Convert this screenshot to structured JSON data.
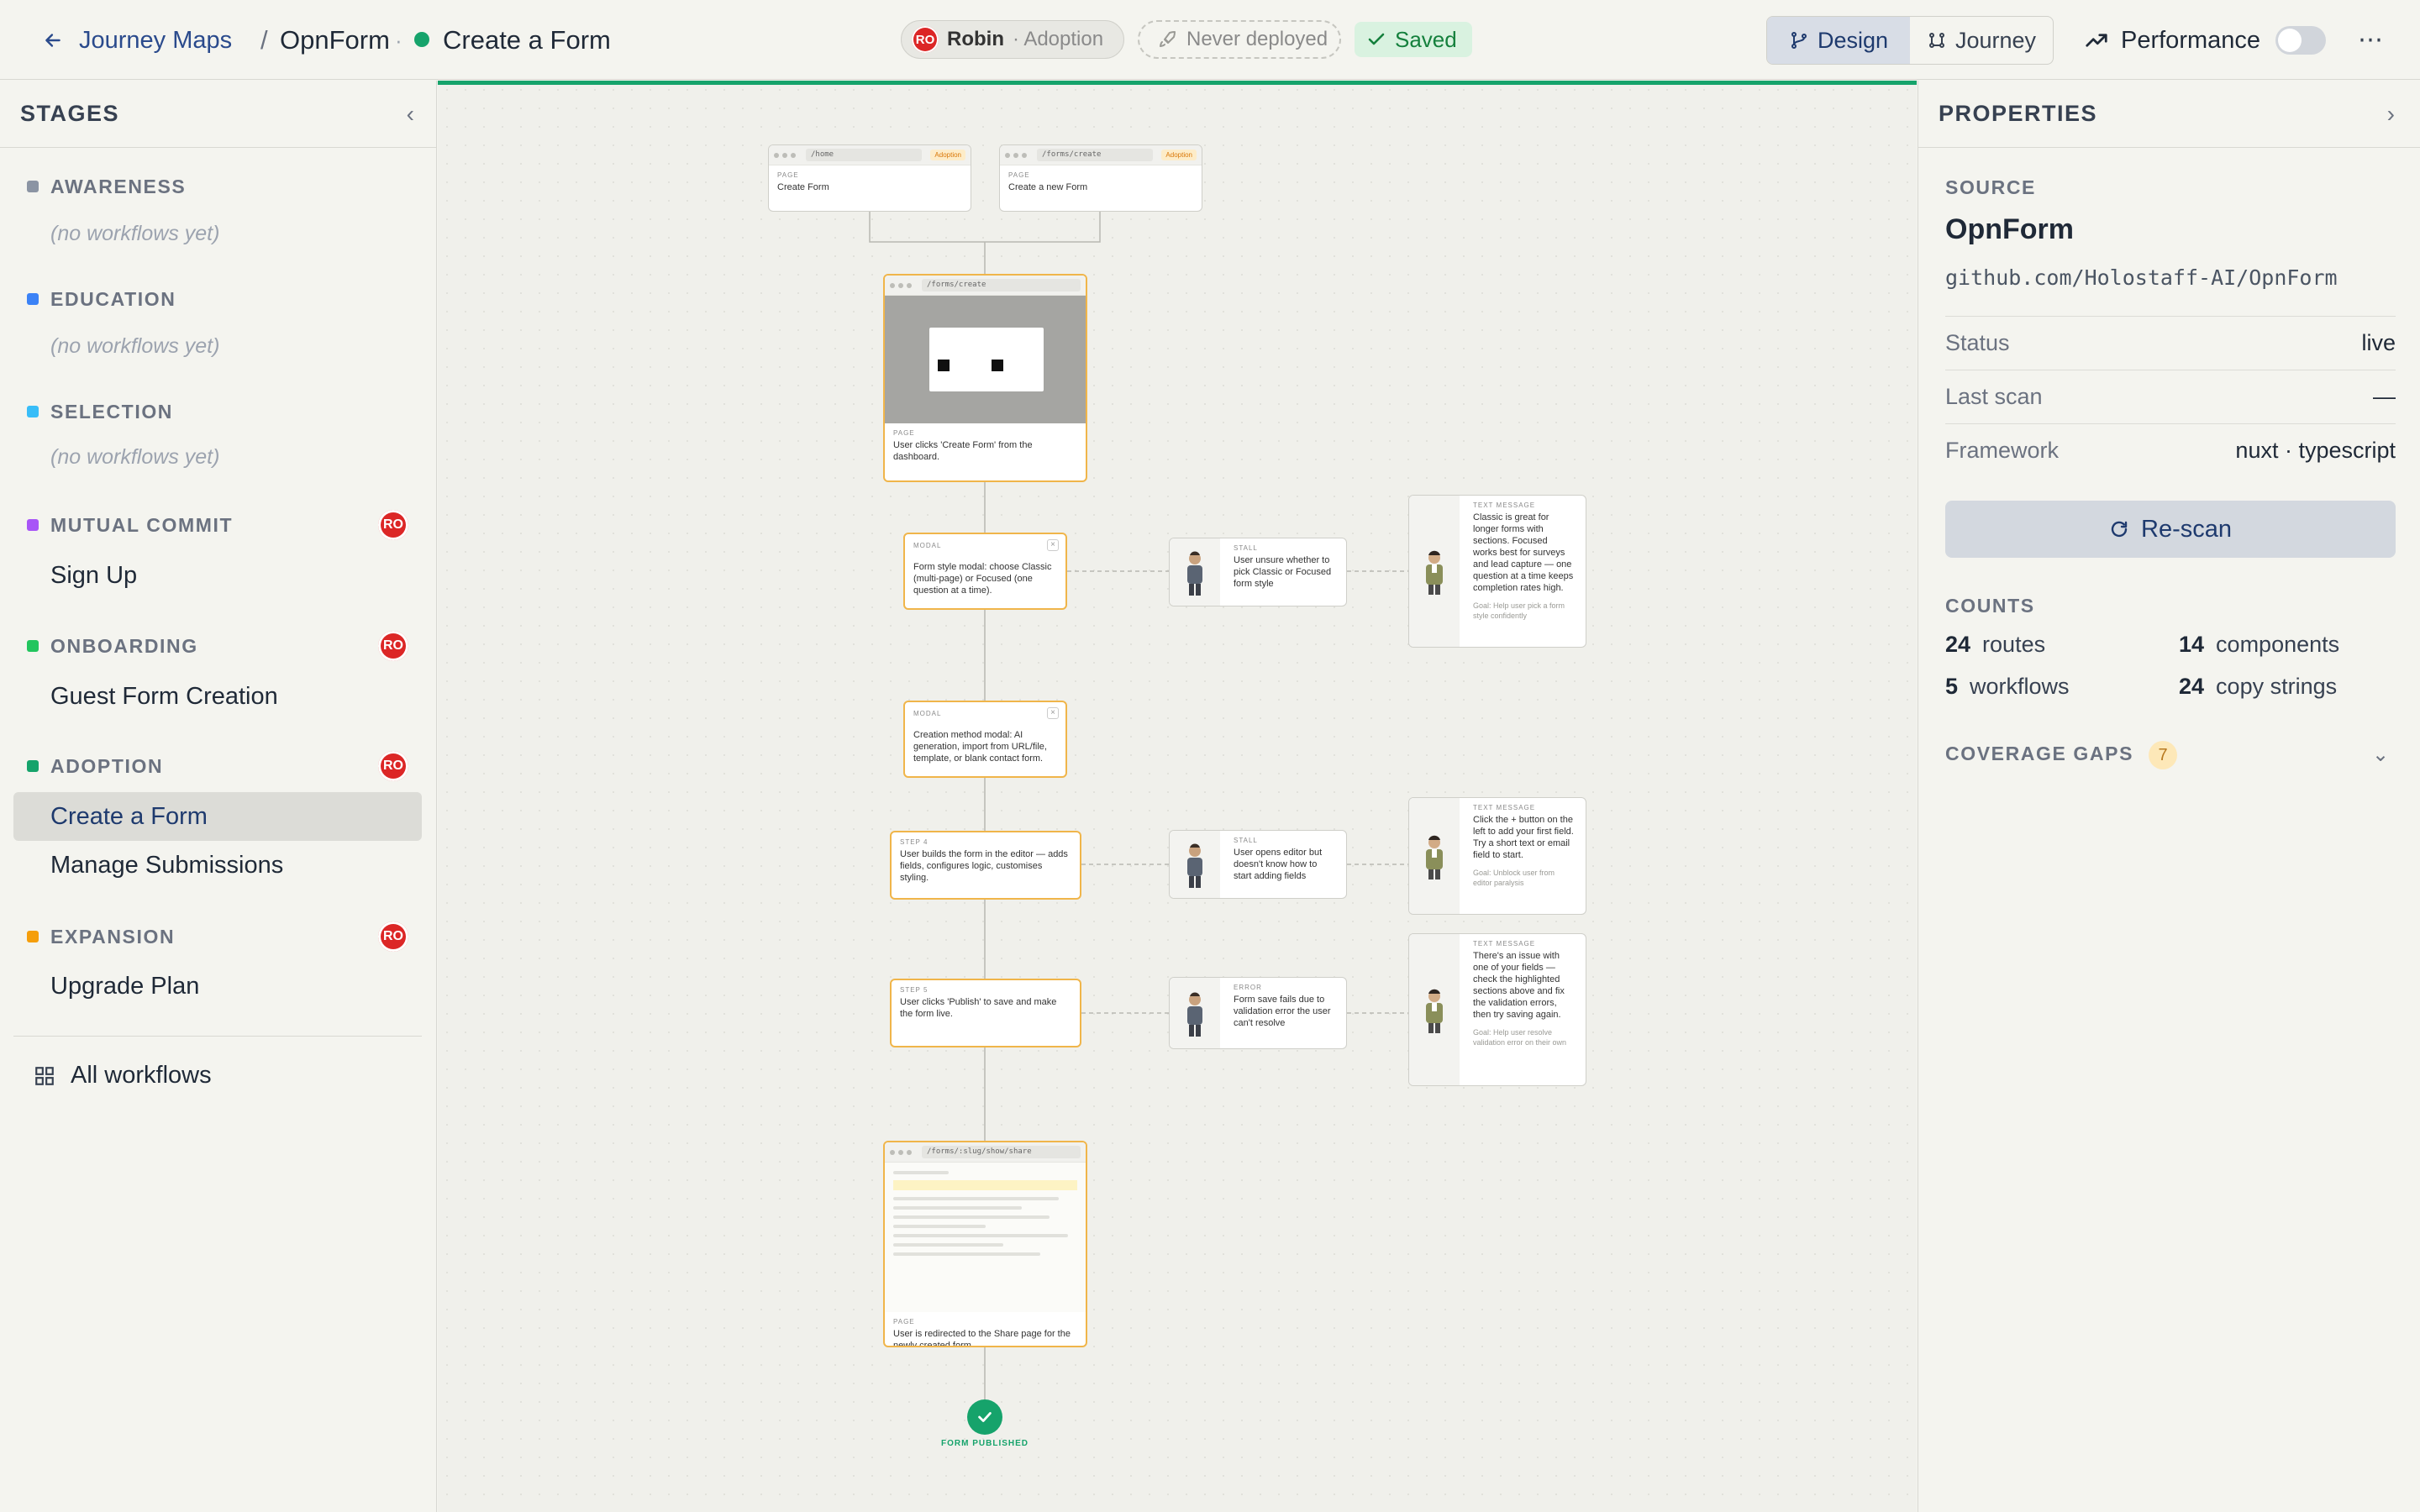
{
  "header": {
    "back_label": "Journey Maps",
    "separator": "/",
    "project": "OpnForm",
    "dot": "·",
    "workflow": "Create a Form",
    "owner_initials": "RO",
    "owner_name": "Robin",
    "owner_stage": "· Adoption",
    "deploy_status": "Never deployed",
    "save_status": "Saved",
    "view_design": "Design",
    "view_journey": "Journey",
    "performance_label": "Performance",
    "more": "⋯"
  },
  "sidebar": {
    "title": "STAGES",
    "stages": [
      {
        "name": "AWARENESS",
        "color": "#8b94a3",
        "empty": "(no workflows yet)"
      },
      {
        "name": "EDUCATION",
        "color": "#3b82f6",
        "empty": "(no workflows yet)"
      },
      {
        "name": "SELECTION",
        "color": "#38bdf8",
        "empty": "(no workflows yet)"
      },
      {
        "name": "MUTUAL COMMIT",
        "color": "#a855f7",
        "badge": "RO",
        "workflow": "Sign Up"
      },
      {
        "name": "ONBOARDING",
        "color": "#22c55e",
        "badge": "RO",
        "workflow": "Guest Form Creation"
      },
      {
        "name": "ADOPTION",
        "color": "#16a36b",
        "badge": "RO",
        "workflows": [
          "Create a Form",
          "Manage Submissions"
        ]
      },
      {
        "name": "EXPANSION",
        "color": "#f59e0b",
        "badge": "RO",
        "workflow": "Upgrade Plan"
      }
    ],
    "all_workflows": "All workflows"
  },
  "canvas": {
    "nodes": {
      "home": {
        "url": "/home",
        "tag": "Adoption",
        "kind": "PAGE",
        "text": "Create Form"
      },
      "forms_create_top": {
        "url": "/forms/create",
        "tag": "Adoption",
        "kind": "PAGE",
        "text": "Create a new Form"
      },
      "page_create": {
        "url": "/forms/create",
        "kind": "PAGE",
        "text": "User clicks 'Create Form' from the dashboard."
      },
      "modal1": {
        "kind": "MODAL",
        "text": "Form style modal: choose Classic (multi-page) or Focused (one question at a time)."
      },
      "stall1": {
        "kind": "STALL",
        "text": "User unsure whether to pick Classic or Focused form style"
      },
      "msg1": {
        "kind": "TEXT MESSAGE",
        "text": "Classic is great for longer forms with sections. Focused works best for surveys and lead capture — one question at a time keeps completion rates high.",
        "goal": "Goal: Help user pick a form style confidently"
      },
      "modal2": {
        "kind": "MODAL",
        "text": "Creation method modal: AI generation, import from URL/file, template, or blank contact form."
      },
      "step4": {
        "kind": "STEP 4",
        "text": "User builds the form in the editor — adds fields, configures logic, customises styling."
      },
      "stall2": {
        "kind": "STALL",
        "text": "User opens editor but doesn't know how to start adding fields"
      },
      "msg2": {
        "kind": "TEXT MESSAGE",
        "text": "Click the + button on the left to add your first field. Try a short text or email field to start.",
        "goal": "Goal: Unblock user from editor paralysis"
      },
      "step5": {
        "kind": "STEP 5",
        "text": "User clicks 'Publish' to save and make the form live."
      },
      "error1": {
        "kind": "ERROR",
        "text": "Form save fails due to validation error the user can't resolve"
      },
      "msg3": {
        "kind": "TEXT MESSAGE",
        "text": "There's an issue with one of your fields — check the highlighted sections above and fix the validation errors, then try saving again.",
        "goal": "Goal: Help user resolve validation error on their own"
      },
      "share": {
        "url": "/forms/:slug/show/share",
        "kind": "PAGE",
        "text": "User is redirected to the Share page for the newly created form."
      }
    },
    "end_label": "FORM PUBLISHED"
  },
  "properties": {
    "title": "PROPERTIES",
    "source_label": "SOURCE",
    "source_name": "OpnForm",
    "repo": "github.com/Holostaff-AI/OpnForm",
    "rows": [
      {
        "key": "Status",
        "value": "live"
      },
      {
        "key": "Last scan",
        "value": "—"
      },
      {
        "key": "Framework",
        "value": "nuxt · typescript"
      }
    ],
    "rescan_label": "Re-scan",
    "counts_label": "COUNTS",
    "counts": [
      {
        "n": "24",
        "label": "routes"
      },
      {
        "n": "14",
        "label": "components"
      },
      {
        "n": "5",
        "label": "workflows"
      },
      {
        "n": "24",
        "label": "copy strings"
      }
    ],
    "coverage_label": "COVERAGE GAPS",
    "coverage_count": "7"
  }
}
